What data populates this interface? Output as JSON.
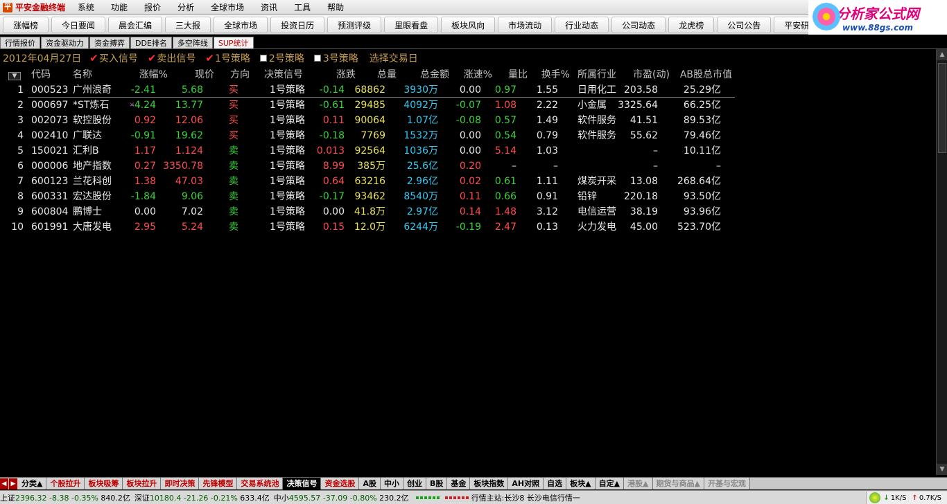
{
  "menubar": {
    "app_title": "平安金融终端",
    "items": [
      "系统",
      "功能",
      "报价",
      "分析",
      "全球市场",
      "资讯",
      "工具",
      "帮助"
    ]
  },
  "brand": {
    "name": "分析家公式网",
    "url_text": "www.88gs.com"
  },
  "quickbar": {
    "buttons": [
      "涨幅榜",
      "今日要闻",
      "晨会汇编",
      "三大报",
      "全球市场",
      "投资日历",
      "预测评级",
      "里眼看盘",
      "板块风向",
      "市场流动",
      "行业动态",
      "公司动态",
      "龙虎榜",
      "公司公告",
      "平安研报"
    ]
  },
  "pagetabs": [
    "行情报价",
    "资金驱动力",
    "资金搏弈",
    "DDE排名",
    "多空阵线",
    "SUP统计"
  ],
  "filter": {
    "date": "2012年04月27日",
    "options": [
      {
        "label": "买入信号",
        "checked": true
      },
      {
        "label": "卖出信号",
        "checked": true
      },
      {
        "label": "1号策略",
        "checked": true
      },
      {
        "label": "2号策略",
        "checked": false
      },
      {
        "label": "3号策略",
        "checked": false
      }
    ],
    "select_day": "选择交易日"
  },
  "table": {
    "headers": [
      "代码",
      "名称",
      "涨幅%",
      "现价",
      "方向",
      "决策信号",
      "涨跌",
      "总量",
      "总金额",
      "涨速%",
      "量比",
      "换手%",
      "所属行业",
      "市盈(动)",
      "AB股总市值"
    ],
    "rows": [
      {
        "no": "1",
        "code": "000523",
        "name": "广州浪奇",
        "flag": "",
        "chg_pct": "-2.41",
        "price": "5.68",
        "dir": "买",
        "signal": "1号策略",
        "chg": "-0.14",
        "vol": "68862",
        "amount": "3930万",
        "speed": "0.00",
        "vratio": "0.97",
        "turnover": "1.55",
        "industry": "日用化工",
        "pe": "203.58",
        "mktcap": "25.29亿"
      },
      {
        "no": "2",
        "code": "000697",
        "name": "*ST炼石",
        "flag": "×",
        "chg_pct": "-4.24",
        "price": "13.77",
        "dir": "买",
        "signal": "1号策略",
        "chg": "-0.61",
        "vol": "29485",
        "amount": "4092万",
        "speed": "-0.07",
        "vratio": "1.08",
        "turnover": "2.22",
        "industry": "小金属",
        "pe": "3325.64",
        "mktcap": "66.25亿"
      },
      {
        "no": "3",
        "code": "002073",
        "name": "软控股份",
        "flag": "",
        "chg_pct": "0.92",
        "price": "12.06",
        "dir": "买",
        "signal": "1号策略",
        "chg": "0.11",
        "vol": "90064",
        "amount": "1.07亿",
        "speed": "-0.08",
        "vratio": "0.57",
        "turnover": "1.49",
        "industry": "软件服务",
        "pe": "41.51",
        "mktcap": "89.53亿"
      },
      {
        "no": "4",
        "code": "002410",
        "name": "广联达",
        "flag": "",
        "chg_pct": "-0.91",
        "price": "19.62",
        "dir": "买",
        "signal": "1号策略",
        "chg": "-0.18",
        "vol": "7769",
        "amount": "1532万",
        "speed": "0.00",
        "vratio": "0.54",
        "turnover": "0.79",
        "industry": "软件服务",
        "pe": "55.62",
        "mktcap": "79.46亿"
      },
      {
        "no": "5",
        "code": "150021",
        "name": "汇利B",
        "flag": "",
        "chg_pct": "1.17",
        "price": "1.124",
        "dir": "卖",
        "signal": "1号策略",
        "chg": "0.013",
        "vol": "92564",
        "amount": "1036万",
        "speed": "0.00",
        "vratio": "5.14",
        "turnover": "1.03",
        "industry": "",
        "pe": "–",
        "mktcap": "10.11亿"
      },
      {
        "no": "6",
        "code": "000006",
        "name": "地产指数",
        "flag": "",
        "chg_pct": "0.27",
        "price": "3350.78",
        "dir": "卖",
        "signal": "1号策略",
        "chg": "8.99",
        "vol": "385万",
        "amount": "25.6亿",
        "speed": "0.20",
        "vratio": "–",
        "turnover": "–",
        "industry": "",
        "pe": "–",
        "mktcap": "–"
      },
      {
        "no": "7",
        "code": "600123",
        "name": "兰花科创",
        "flag": "",
        "chg_pct": "1.38",
        "price": "47.03",
        "dir": "卖",
        "signal": "1号策略",
        "chg": "0.64",
        "vol": "63216",
        "amount": "2.96亿",
        "speed": "0.02",
        "vratio": "0.61",
        "turnover": "1.11",
        "industry": "煤炭开采",
        "pe": "13.08",
        "mktcap": "268.64亿"
      },
      {
        "no": "8",
        "code": "600331",
        "name": "宏达股份",
        "flag": "",
        "chg_pct": "-1.84",
        "price": "9.06",
        "dir": "卖",
        "signal": "1号策略",
        "chg": "-0.17",
        "vol": "93462",
        "amount": "8540万",
        "speed": "0.11",
        "vratio": "0.66",
        "turnover": "0.91",
        "industry": "铅锌",
        "pe": "220.18",
        "mktcap": "93.50亿"
      },
      {
        "no": "9",
        "code": "600804",
        "name": "鹏博士",
        "flag": "",
        "chg_pct": "0.00",
        "price": "7.02",
        "dir": "卖",
        "signal": "1号策略",
        "chg": "0.00",
        "vol": "41.8万",
        "amount": "2.97亿",
        "speed": "0.14",
        "vratio": "1.48",
        "turnover": "3.12",
        "industry": "电信运营",
        "pe": "38.19",
        "mktcap": "93.96亿"
      },
      {
        "no": "10",
        "code": "601991",
        "name": "大唐发电",
        "flag": "",
        "chg_pct": "2.95",
        "price": "5.24",
        "dir": "卖",
        "signal": "1号策略",
        "chg": "0.15",
        "vol": "12.0万",
        "amount": "6244万",
        "speed": "-0.19",
        "vratio": "2.47",
        "turnover": "0.13",
        "industry": "火力发电",
        "pe": "45.00",
        "mktcap": "523.70亿"
      }
    ]
  },
  "bottomtabs": [
    {
      "label": "分类▲",
      "style": ""
    },
    {
      "label": "个股拉升",
      "style": "red"
    },
    {
      "label": "板块吸筹",
      "style": "red"
    },
    {
      "label": "板块拉升",
      "style": "red"
    },
    {
      "label": "即时决策",
      "style": "red"
    },
    {
      "label": "先锋模型",
      "style": "red"
    },
    {
      "label": "交易系统池",
      "style": "red"
    },
    {
      "label": "决策信号",
      "style": "active"
    },
    {
      "label": "资金选股",
      "style": "red"
    },
    {
      "label": "A股",
      "style": ""
    },
    {
      "label": "中小",
      "style": ""
    },
    {
      "label": "创业",
      "style": ""
    },
    {
      "label": "B股",
      "style": ""
    },
    {
      "label": "基金",
      "style": ""
    },
    {
      "label": "板块指数",
      "style": ""
    },
    {
      "label": "AH对照",
      "style": ""
    },
    {
      "label": "自选",
      "style": ""
    },
    {
      "label": "板块▲",
      "style": ""
    },
    {
      "label": "自定▲",
      "style": ""
    },
    {
      "label": "港股▲",
      "style": "gray"
    },
    {
      "label": "期货与商品▲",
      "style": "gray"
    },
    {
      "label": "开基与宏观",
      "style": "gray"
    }
  ],
  "statusbar": {
    "sh_label": "上证",
    "sh_val": "2396.32",
    "sh_chg": "-8.38",
    "sh_pct": "-0.35%",
    "sh_amt": "840.2亿",
    "sz_label": "深证",
    "sz_val": "10180.4",
    "sz_chg": "-21.26",
    "sz_pct": "-0.21%",
    "sz_amt": "633.4亿",
    "zx_label": "中小",
    "zx_val": "4595.57",
    "zx_chg": "-37.09",
    "zx_pct": "-0.80%",
    "zx_amt": "230.2亿",
    "server": "行情主站:长沙8 长沙电信行情一",
    "down_speed": "1K/S",
    "up_speed": "0.7K/S"
  },
  "colors": {
    "up": "#ff4c4c",
    "down": "#3ad23a",
    "amount": "#35c8f0",
    "accent_red": "#c00000"
  }
}
